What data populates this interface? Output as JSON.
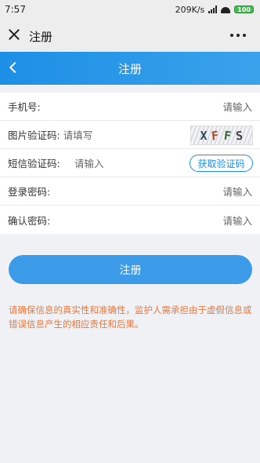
{
  "status_bar": {
    "time": "7:57",
    "network_speed": "209K/s",
    "battery": "100"
  },
  "wechat_bar": {
    "title": "注册",
    "close_icon": "close-icon",
    "more_icon": "more-icon"
  },
  "header": {
    "title": "注册",
    "back_icon": "back-icon",
    "gradient": [
      "#1d8fe6",
      "#3aa2ea"
    ]
  },
  "form": {
    "phone": {
      "label": "手机号:",
      "placeholder": "请输入"
    },
    "image_code": {
      "label": "图片验证码:",
      "placeholder": "请填写",
      "captcha": [
        "X",
        "F",
        "F",
        "S"
      ]
    },
    "sms_code": {
      "label": "短信验证码:",
      "placeholder": "请输入",
      "button": "获取验证码"
    },
    "password": {
      "label": "登录密码:",
      "placeholder": "请输入"
    },
    "confirm_password": {
      "label": "确认密码:",
      "placeholder": "请输入"
    }
  },
  "submit": {
    "label": "注册"
  },
  "notice": "请确保信息的真实性和准确性，监护人需承担由于虚假信息或错误信息产生的相应责任和后果。",
  "colors": {
    "accent": "#1d8fe6",
    "notice": "#e7793f",
    "background": "#f0f1f5"
  }
}
